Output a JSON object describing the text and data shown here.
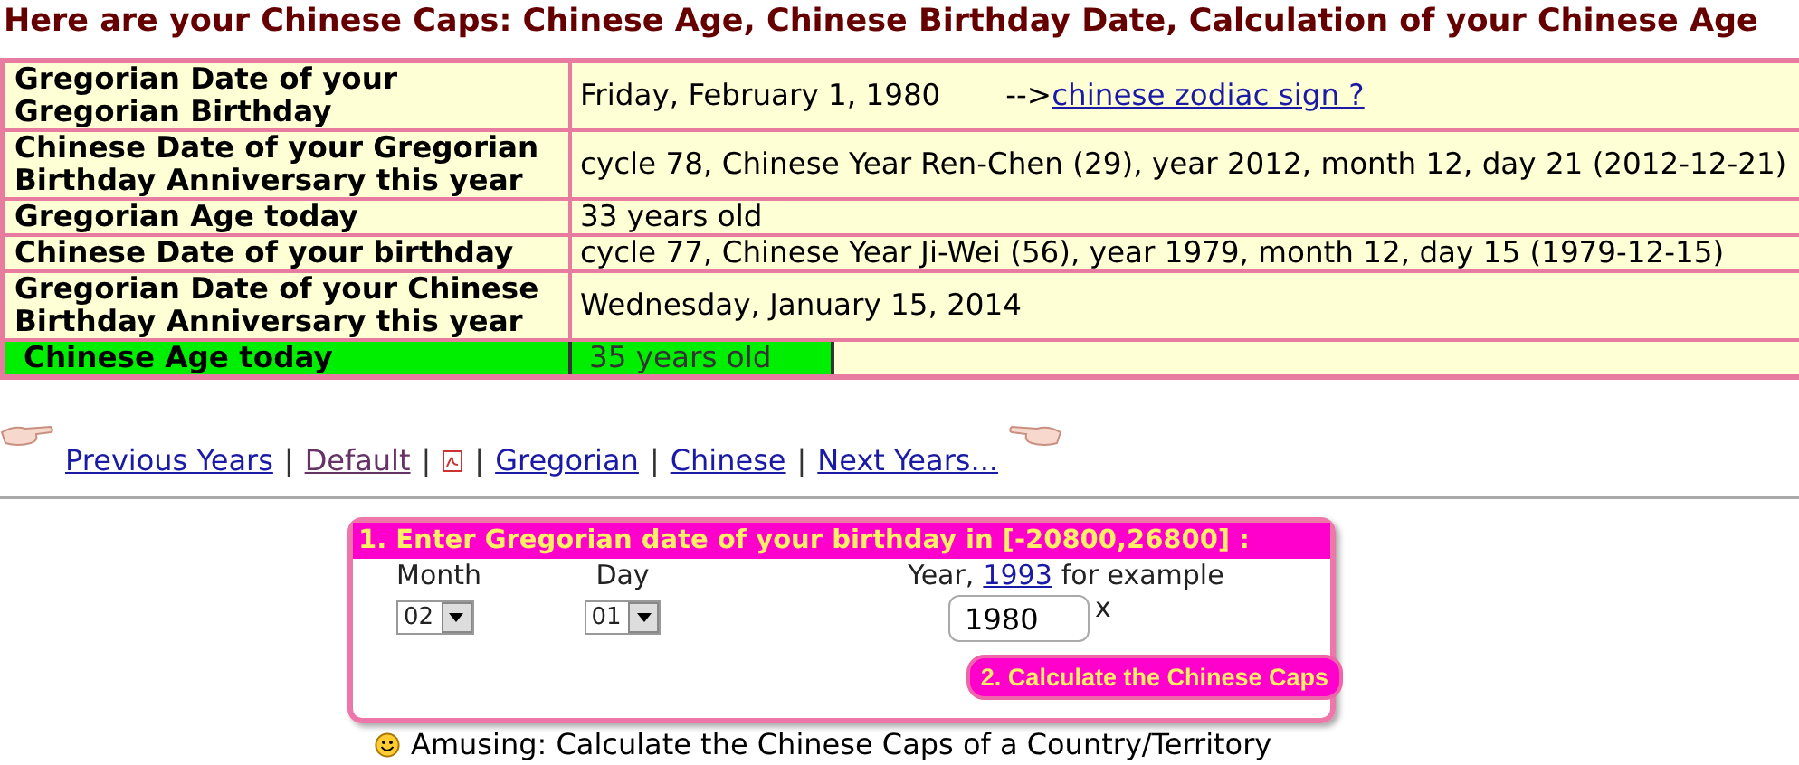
{
  "title": "Here are your Chinese Caps: Chinese Age, Chinese Birthday Date, Calculation of your Chinese Age",
  "table": {
    "rows": [
      {
        "kind": "normal",
        "label": "Gregorian Date of your Gregorian Birthday",
        "value": "Friday, February 1, 1980",
        "link_prefix": "-->",
        "link": "chinese zodiac sign ?"
      },
      {
        "kind": "normal",
        "label": "Chinese Date of your Gregorian Birthday Anniversary this year",
        "value": "cycle 78, Chinese Year Ren-Chen (29), year 2012, month 12, day 21 (2012-12-21)"
      },
      {
        "kind": "normal",
        "label": "Gregorian Age today",
        "value": "33 years old"
      },
      {
        "kind": "normal",
        "label": "Chinese Date of your birthday",
        "value": "cycle 77, Chinese Year Ji-Wei (56), year 1979, month 12, day 15 (1979-12-15)"
      },
      {
        "kind": "normal",
        "label": "Gregorian Date of your Chinese Birthday Anniversary this year",
        "value": "Wednesday, January 15, 2014"
      },
      {
        "kind": "highlight",
        "label": "Chinese Age today",
        "value": "35 years old"
      }
    ]
  },
  "nav": [
    {
      "kind": "link",
      "label": "Previous Years",
      "visited": false
    },
    {
      "kind": "link",
      "label": "Default",
      "visited": true
    },
    {
      "kind": "pdf"
    },
    {
      "kind": "link",
      "label": "Gregorian",
      "visited": false
    },
    {
      "kind": "link",
      "label": "Chinese",
      "visited": false
    },
    {
      "kind": "link",
      "label": "Next Years...",
      "visited": false
    }
  ],
  "nav_separator": "|",
  "form": {
    "heading": "1. Enter Gregorian date of your birthday in [-20800,26800] :",
    "month_label": "Month",
    "month": "02",
    "day_label": "Day",
    "day": "01",
    "year_label_prefix": "Year,",
    "year_example": "1993",
    "year_label_suffix": "for example",
    "year": "1980",
    "clear": "x",
    "button": "2. Calculate the Chinese Caps"
  },
  "footer": "Amusing: Calculate the Chinese Caps of a Country/Territory"
}
